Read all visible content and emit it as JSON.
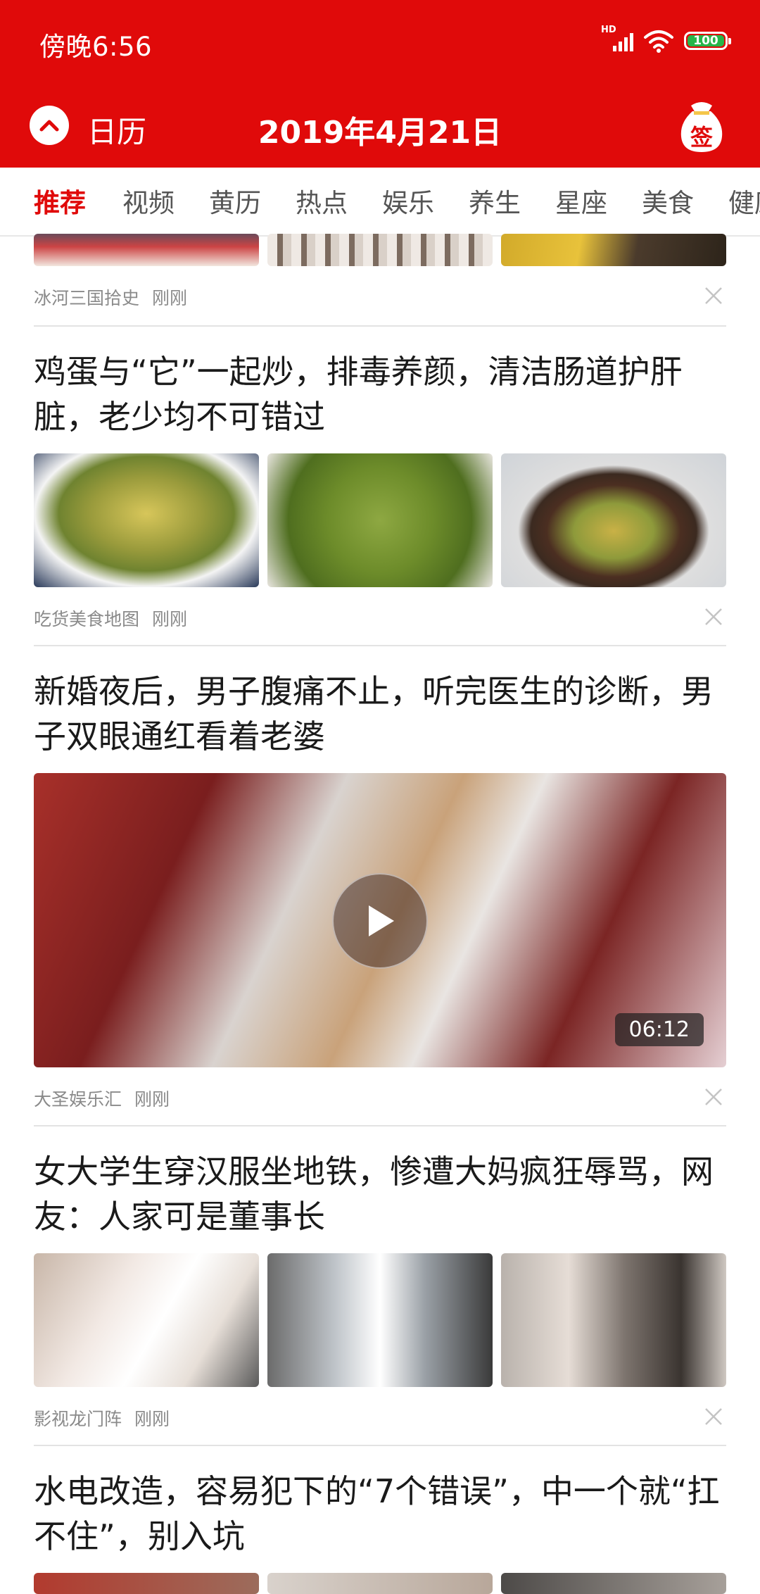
{
  "status": {
    "time": "傍晚6:56",
    "network": "HD",
    "battery": "100"
  },
  "header": {
    "back_label": "日历",
    "title": "2019年4月21日",
    "sign_label": "签"
  },
  "tabs": [
    "推荐",
    "视频",
    "黄历",
    "热点",
    "娱乐",
    "养生",
    "星座",
    "美食",
    "健康"
  ],
  "feed": [
    {
      "source": "冰河三国拾史",
      "time": "刚刚"
    },
    {
      "title": "鸡蛋与“它”一起炒，排毒养颜，清洁肠道护肝脏，老少均不可错过",
      "source": "吃货美食地图",
      "time": "刚刚"
    },
    {
      "title": "新婚夜后，男子腹痛不止，听完医生的诊断，男子双眼通红看着老婆",
      "duration": "06:12",
      "source": "大圣娱乐汇",
      "time": "刚刚"
    },
    {
      "title": "女大学生穿汉服坐地铁，惨遭大妈疯狂辱骂，网友：人家可是董事长",
      "source": "影视龙门阵",
      "time": "刚刚"
    },
    {
      "title": "水电改造，容易犯下的“7个错误”，中一个就“扛不住”，别入坑"
    }
  ],
  "colors": {
    "brand_red": "#e00a0a",
    "battery_green": "#27b54a"
  },
  "icons": [
    "back-chevron-up-icon",
    "sign-bag-icon",
    "signal-icon",
    "wifi-icon",
    "battery-icon",
    "close-icon",
    "play-icon"
  ]
}
